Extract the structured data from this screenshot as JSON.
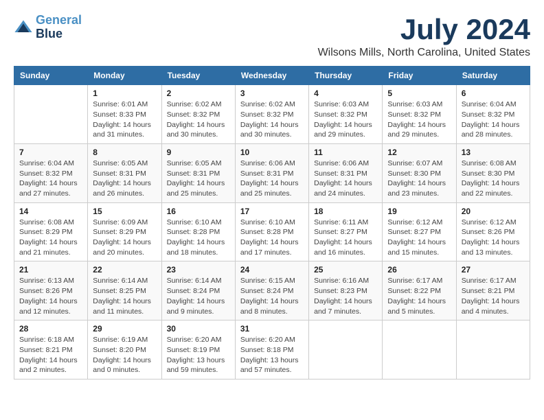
{
  "logo": {
    "line1": "General",
    "line2": "Blue"
  },
  "title": "July 2024",
  "subtitle": "Wilsons Mills, North Carolina, United States",
  "weekdays": [
    "Sunday",
    "Monday",
    "Tuesday",
    "Wednesday",
    "Thursday",
    "Friday",
    "Saturday"
  ],
  "weeks": [
    [
      {
        "day": "",
        "info": ""
      },
      {
        "day": "1",
        "info": "Sunrise: 6:01 AM\nSunset: 8:33 PM\nDaylight: 14 hours\nand 31 minutes."
      },
      {
        "day": "2",
        "info": "Sunrise: 6:02 AM\nSunset: 8:32 PM\nDaylight: 14 hours\nand 30 minutes."
      },
      {
        "day": "3",
        "info": "Sunrise: 6:02 AM\nSunset: 8:32 PM\nDaylight: 14 hours\nand 30 minutes."
      },
      {
        "day": "4",
        "info": "Sunrise: 6:03 AM\nSunset: 8:32 PM\nDaylight: 14 hours\nand 29 minutes."
      },
      {
        "day": "5",
        "info": "Sunrise: 6:03 AM\nSunset: 8:32 PM\nDaylight: 14 hours\nand 29 minutes."
      },
      {
        "day": "6",
        "info": "Sunrise: 6:04 AM\nSunset: 8:32 PM\nDaylight: 14 hours\nand 28 minutes."
      }
    ],
    [
      {
        "day": "7",
        "info": "Sunrise: 6:04 AM\nSunset: 8:32 PM\nDaylight: 14 hours\nand 27 minutes."
      },
      {
        "day": "8",
        "info": "Sunrise: 6:05 AM\nSunset: 8:31 PM\nDaylight: 14 hours\nand 26 minutes."
      },
      {
        "day": "9",
        "info": "Sunrise: 6:05 AM\nSunset: 8:31 PM\nDaylight: 14 hours\nand 25 minutes."
      },
      {
        "day": "10",
        "info": "Sunrise: 6:06 AM\nSunset: 8:31 PM\nDaylight: 14 hours\nand 25 minutes."
      },
      {
        "day": "11",
        "info": "Sunrise: 6:06 AM\nSunset: 8:31 PM\nDaylight: 14 hours\nand 24 minutes."
      },
      {
        "day": "12",
        "info": "Sunrise: 6:07 AM\nSunset: 8:30 PM\nDaylight: 14 hours\nand 23 minutes."
      },
      {
        "day": "13",
        "info": "Sunrise: 6:08 AM\nSunset: 8:30 PM\nDaylight: 14 hours\nand 22 minutes."
      }
    ],
    [
      {
        "day": "14",
        "info": "Sunrise: 6:08 AM\nSunset: 8:29 PM\nDaylight: 14 hours\nand 21 minutes."
      },
      {
        "day": "15",
        "info": "Sunrise: 6:09 AM\nSunset: 8:29 PM\nDaylight: 14 hours\nand 20 minutes."
      },
      {
        "day": "16",
        "info": "Sunrise: 6:10 AM\nSunset: 8:28 PM\nDaylight: 14 hours\nand 18 minutes."
      },
      {
        "day": "17",
        "info": "Sunrise: 6:10 AM\nSunset: 8:28 PM\nDaylight: 14 hours\nand 17 minutes."
      },
      {
        "day": "18",
        "info": "Sunrise: 6:11 AM\nSunset: 8:27 PM\nDaylight: 14 hours\nand 16 minutes."
      },
      {
        "day": "19",
        "info": "Sunrise: 6:12 AM\nSunset: 8:27 PM\nDaylight: 14 hours\nand 15 minutes."
      },
      {
        "day": "20",
        "info": "Sunrise: 6:12 AM\nSunset: 8:26 PM\nDaylight: 14 hours\nand 13 minutes."
      }
    ],
    [
      {
        "day": "21",
        "info": "Sunrise: 6:13 AM\nSunset: 8:26 PM\nDaylight: 14 hours\nand 12 minutes."
      },
      {
        "day": "22",
        "info": "Sunrise: 6:14 AM\nSunset: 8:25 PM\nDaylight: 14 hours\nand 11 minutes."
      },
      {
        "day": "23",
        "info": "Sunrise: 6:14 AM\nSunset: 8:24 PM\nDaylight: 14 hours\nand 9 minutes."
      },
      {
        "day": "24",
        "info": "Sunrise: 6:15 AM\nSunset: 8:24 PM\nDaylight: 14 hours\nand 8 minutes."
      },
      {
        "day": "25",
        "info": "Sunrise: 6:16 AM\nSunset: 8:23 PM\nDaylight: 14 hours\nand 7 minutes."
      },
      {
        "day": "26",
        "info": "Sunrise: 6:17 AM\nSunset: 8:22 PM\nDaylight: 14 hours\nand 5 minutes."
      },
      {
        "day": "27",
        "info": "Sunrise: 6:17 AM\nSunset: 8:21 PM\nDaylight: 14 hours\nand 4 minutes."
      }
    ],
    [
      {
        "day": "28",
        "info": "Sunrise: 6:18 AM\nSunset: 8:21 PM\nDaylight: 14 hours\nand 2 minutes."
      },
      {
        "day": "29",
        "info": "Sunrise: 6:19 AM\nSunset: 8:20 PM\nDaylight: 14 hours\nand 0 minutes."
      },
      {
        "day": "30",
        "info": "Sunrise: 6:20 AM\nSunset: 8:19 PM\nDaylight: 13 hours\nand 59 minutes."
      },
      {
        "day": "31",
        "info": "Sunrise: 6:20 AM\nSunset: 8:18 PM\nDaylight: 13 hours\nand 57 minutes."
      },
      {
        "day": "",
        "info": ""
      },
      {
        "day": "",
        "info": ""
      },
      {
        "day": "",
        "info": ""
      }
    ]
  ]
}
